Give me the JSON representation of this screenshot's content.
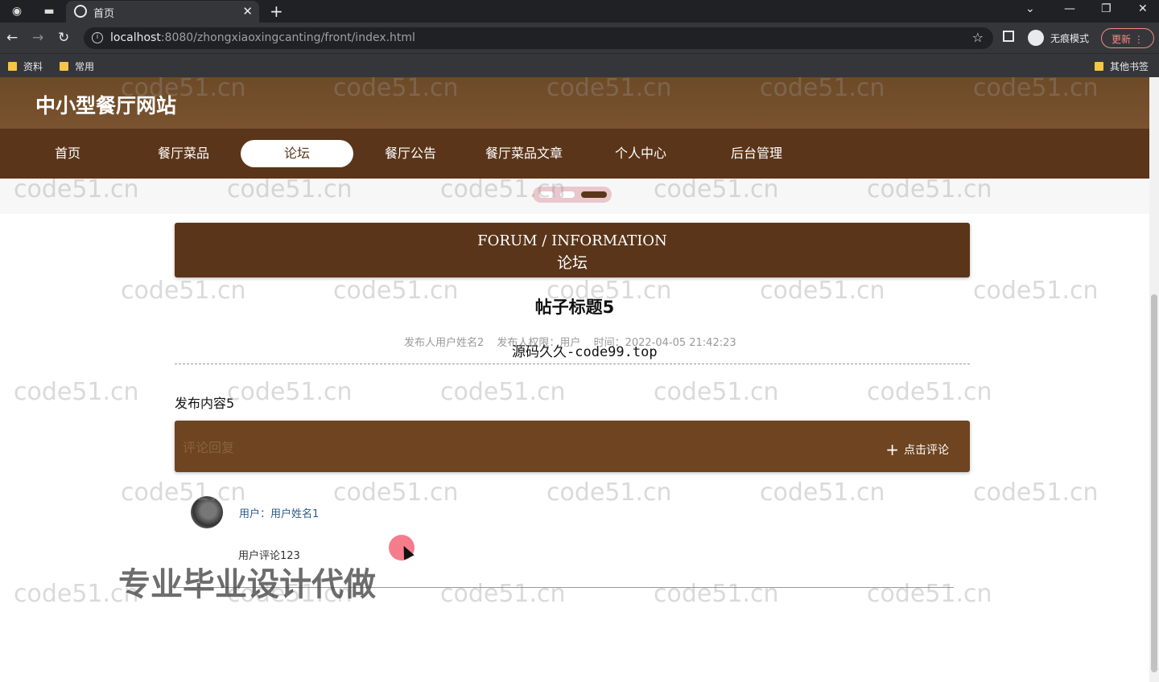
{
  "browser": {
    "tab_title": "首页",
    "url_host": "localhost",
    "url_rest": ":8080/zhongxiaoxingcanting/front/index.html",
    "incognito_label": "无痕模式",
    "update_label": "更新",
    "bookmarks": [
      "资料",
      "常用"
    ],
    "other_bookmarks": "其他书签"
  },
  "site": {
    "title": "中小型餐厅网站",
    "nav": [
      "首页",
      "餐厅菜品",
      "论坛",
      "餐厅公告",
      "餐厅菜品文章",
      "个人中心",
      "后台管理"
    ],
    "active_nav": "论坛"
  },
  "forum": {
    "banner_en": "FORUM / INFORMATION",
    "banner_cn": "论坛",
    "post_title": "帖子标题5",
    "meta_author": "发布人用户姓名2",
    "meta_role": "发布人权限：用户",
    "meta_time": "时间：2022-04-05 21:42:23",
    "content": "发布内容5",
    "comment_placeholder": "评论回复",
    "comment_button": "点击评论",
    "comments": [
      {
        "user": "用户：用户姓名1",
        "text": "用户评论123"
      }
    ]
  },
  "watermarks": {
    "site": "code51.cn",
    "mid": "源码久久-code99.top",
    "big": "专业毕业设计代做"
  },
  "colors": {
    "header": "#7a5330",
    "nav": "#5a3519",
    "comment_bar": "#6e4520"
  }
}
